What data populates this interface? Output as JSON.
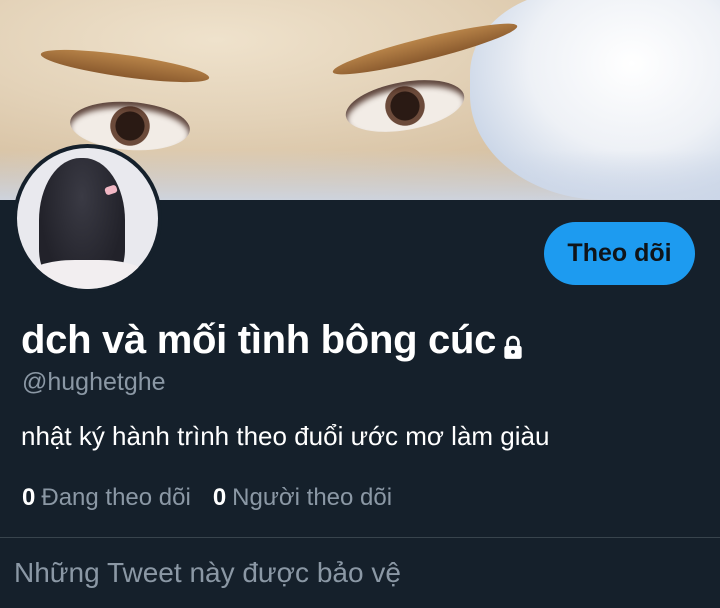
{
  "profile": {
    "display_name": "dch và mối tình bông cúc",
    "handle": "@hughetghe",
    "bio": "nhật ký hành trình theo đuổi ước mơ làm giàu",
    "protected": true
  },
  "actions": {
    "follow_label": "Theo dõi"
  },
  "stats": {
    "following_count": "0",
    "following_label": "Đang theo dõi",
    "followers_count": "0",
    "followers_label": "Người theo dõi"
  },
  "timeline": {
    "protected_message": "Những Tweet này được bảo vệ"
  },
  "icons": {
    "lock": "lock-icon"
  },
  "colors": {
    "background": "#15202b",
    "accent": "#1d9bf0",
    "secondary_text": "#8b98a5",
    "primary_text": "#ffffff",
    "divider": "#38444d"
  }
}
